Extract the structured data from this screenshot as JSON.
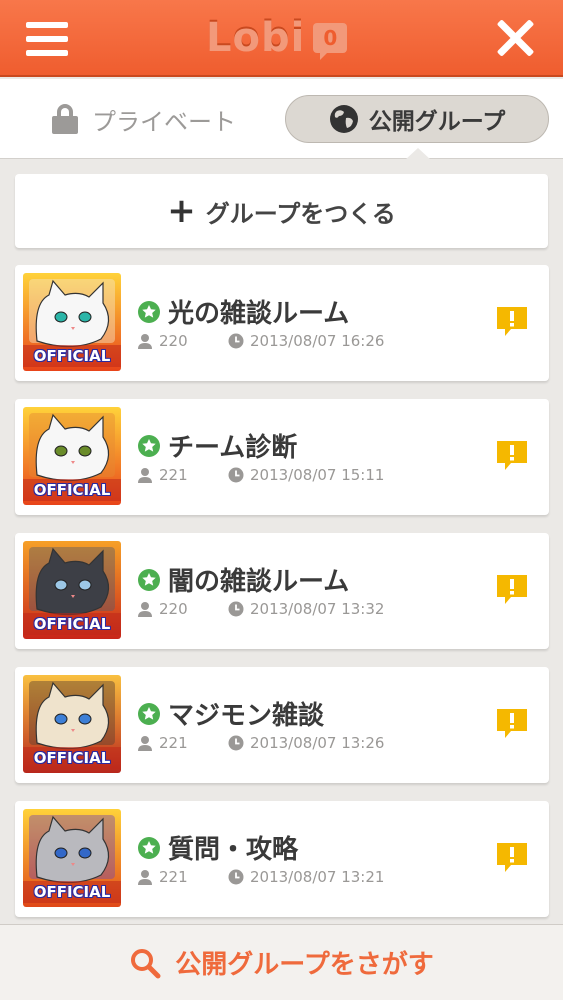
{
  "header": {
    "logo_text": "Lobi",
    "logo_badge": "0",
    "menu_icon": "hamburger-menu-icon",
    "close_icon": "close-icon",
    "brand_color": "#ef5d2f"
  },
  "tabs": {
    "private_label": "プライベート",
    "public_label": "公開グループ",
    "active": "public"
  },
  "create_group": {
    "label": "グループをつくる"
  },
  "groups": [
    {
      "name": "光の雑談ルーム",
      "members": "220",
      "updated": "2013/08/07 16:26",
      "badge": "OFFICIAL",
      "theme": "white-cat"
    },
    {
      "name": "チーム診断",
      "members": "221",
      "updated": "2013/08/07 15:11",
      "badge": "OFFICIAL",
      "theme": "calico-cat"
    },
    {
      "name": "闇の雑談ルーム",
      "members": "220",
      "updated": "2013/08/07 13:32",
      "badge": "OFFICIAL",
      "theme": "black-cat"
    },
    {
      "name": "マジモン雑談",
      "members": "221",
      "updated": "2013/08/07 13:26",
      "badge": "OFFICIAL",
      "theme": "siamese-cat"
    },
    {
      "name": "質問・攻略",
      "members": "221",
      "updated": "2013/08/07 13:21",
      "badge": "OFFICIAL",
      "theme": "gray-cat"
    }
  ],
  "bottom_bar": {
    "label": "公開グループをさがす"
  },
  "colors": {
    "accent": "#ef6a3c",
    "star_green": "#4caf50",
    "notice_yellow": "#f5b800",
    "background": "#ebe9e6"
  }
}
